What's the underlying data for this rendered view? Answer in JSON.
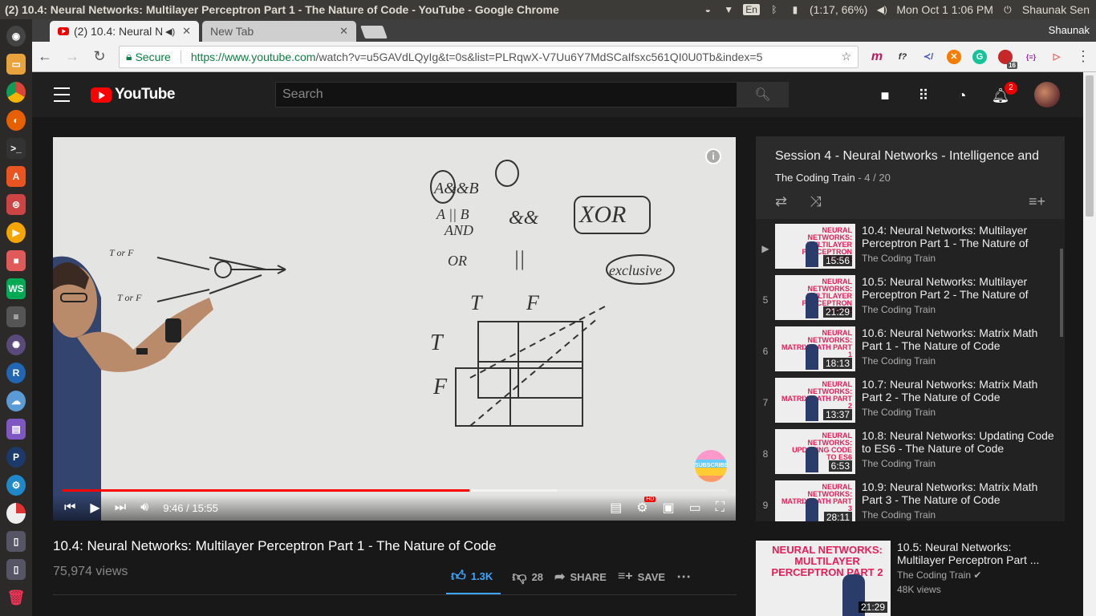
{
  "os": {
    "window_title": "(2) 10.4: Neural Networks: Multilayer Perceptron Part 1 - The Nature of Code - YouTube - Google Chrome",
    "battery": "(1:17, 66%)",
    "clock": "Mon Oct  1  1:06 PM",
    "user": "Shaunak Sen",
    "keyboard": "En"
  },
  "browser": {
    "tabs": [
      {
        "label": "(2) 10.4: Neural N"
      },
      {
        "label": "New Tab"
      }
    ],
    "profile": "Shaunak",
    "secure_label": "Secure",
    "url_host": "https://www.youtube.com",
    "url_path": "/watch?v=u5GAVdLQyIg&t=0s&list=PLRqwX-V7Uu6Y7MdSCaIfsxc561QI0U0Tb&index=5",
    "ext_badge": "16"
  },
  "youtube": {
    "logo_text": "YouTube",
    "search_placeholder": "Search",
    "notification_count": "2",
    "player": {
      "time": "9:46 / 15:55",
      "progress": 0.613,
      "buffered": 0.744,
      "hd_badge": "HD",
      "subscribe_watermark": "SUBSCRIBE"
    },
    "video": {
      "title": "10.4: Neural Networks: Multilayer Perceptron Part 1 - The Nature of Code",
      "views": "75,974 views",
      "likes": "1.3K",
      "dislikes": "28",
      "share_label": "SHARE",
      "save_label": "SAVE"
    },
    "playlist": {
      "title": "Session 4 - Neural Networks - Intelligence and",
      "channel": "The Coding Train",
      "position": " - 4 / 20",
      "items": [
        {
          "idx": "▶",
          "thumb": "NEURAL NETWORKS: MULTILAYER PERCEPTRON PART 1",
          "duration": "15:56",
          "title": "10.4: Neural Networks: Multilayer Perceptron Part 1 - The Nature of",
          "channel": "The Coding Train"
        },
        {
          "idx": "5",
          "thumb": "NEURAL NETWORKS: MULTILAYER PERCEPTRON PART 2",
          "duration": "21:29",
          "title": "10.5: Neural Networks: Multilayer Perceptron Part 2 - The Nature of",
          "channel": "The Coding Train"
        },
        {
          "idx": "6",
          "thumb": "NEURAL NETWORKS: MATRIX MATH PART 1",
          "duration": "18:13",
          "title": "10.6: Neural Networks: Matrix Math Part 1 - The Nature of Code",
          "channel": "The Coding Train"
        },
        {
          "idx": "7",
          "thumb": "NEURAL NETWORKS: MATRIX MATH PART 2",
          "duration": "13:37",
          "title": "10.7: Neural Networks: Matrix Math Part 2 - The Nature of Code",
          "channel": "The Coding Train"
        },
        {
          "idx": "8",
          "thumb": "NEURAL NETWORKS: UPDATING CODE TO ES6",
          "duration": "6:53",
          "title": "10.8: Neural Networks: Updating Code to ES6 - The Nature of Code",
          "channel": "The Coding Train"
        },
        {
          "idx": "9",
          "thumb": "NEURAL NETWORKS: MATRIX MATH PART 3",
          "duration": "28:11",
          "title": "10.9: Neural Networks: Matrix Math Part 3 - The Nature of Code",
          "channel": "The Coding Train"
        }
      ]
    },
    "recommended": {
      "thumb": "NEURAL NETWORKS: MULTILAYER PERCEPTRON PART 2",
      "duration": "21:29",
      "title": "10.5: Neural Networks: Multilayer Perceptron Part ...",
      "channel": "The Coding Train",
      "views": "48K views"
    },
    "whiteboard": {
      "texts": [
        "A&&B",
        "A || B",
        "AND",
        "OR",
        "&&",
        "||",
        "XOR",
        "exclusive",
        "T",
        "F",
        "T",
        "F",
        "T or F",
        "T or F"
      ]
    }
  }
}
